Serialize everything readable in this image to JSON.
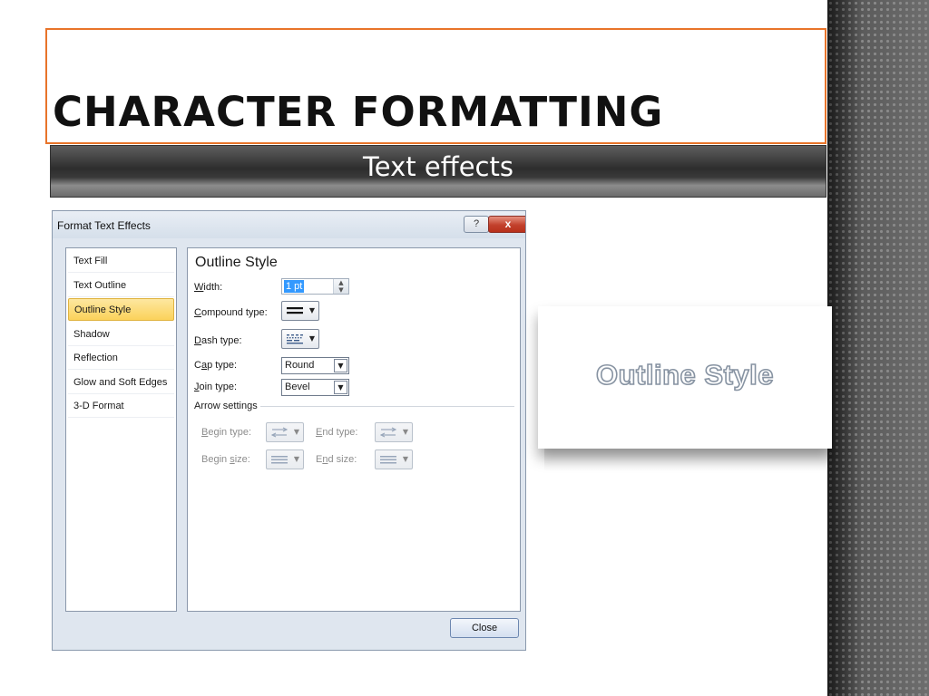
{
  "slide": {
    "title": "CHARACTER FORMATTING",
    "subtitle": "Text effects"
  },
  "dialog": {
    "title": "Format Text Effects",
    "help_label": "?",
    "close_x_label": "x",
    "categories": [
      {
        "label": "Text Fill",
        "selected": false
      },
      {
        "label": "Text Outline",
        "selected": false
      },
      {
        "label": "Outline Style",
        "selected": true
      },
      {
        "label": "Shadow",
        "selected": false
      },
      {
        "label": "Reflection",
        "selected": false
      },
      {
        "label": "Glow and Soft Edges",
        "selected": false
      },
      {
        "label": "3-D Format",
        "selected": false
      }
    ],
    "section_heading": "Outline Style",
    "width": {
      "label_u": "W",
      "label_rest": "idth:",
      "value": "1 pt"
    },
    "compound_type": {
      "label_u": "C",
      "label_rest": "ompound type:",
      "icon": "compound-lines-icon"
    },
    "dash_type": {
      "label_u": "D",
      "label_rest": "ash type:",
      "icon": "dash-lines-icon"
    },
    "cap_type": {
      "label_pre": "C",
      "label_u": "a",
      "label_rest": "p type:",
      "value": "Round"
    },
    "join_type": {
      "label_u": "J",
      "label_rest": "oin type:",
      "value": "Bevel"
    },
    "arrow_settings": {
      "heading": "Arrow settings",
      "begin_type": {
        "label_u": "B",
        "label_rest": "egin type:"
      },
      "end_type": {
        "label_u": "E",
        "label_rest": "nd type:"
      },
      "begin_size": {
        "label_pre": "Begin ",
        "label_u": "s",
        "label_rest": "ize:"
      },
      "end_size": {
        "label_pre": "E",
        "label_u": "n",
        "label_rest": "d size:"
      }
    },
    "close_button": "Close"
  },
  "preview": {
    "text": "Outline Style"
  },
  "colors": {
    "title_border": "#e8742a",
    "selected_category": "#fbd25a",
    "preview_outline": "#8793a2"
  }
}
